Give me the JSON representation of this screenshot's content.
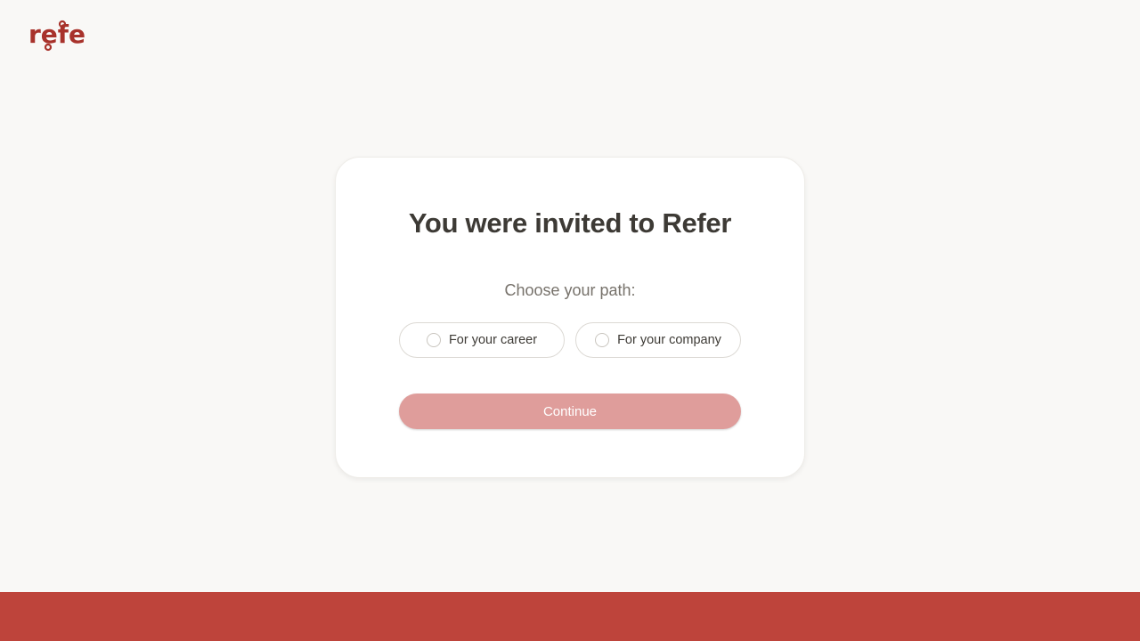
{
  "brand": {
    "logo_text": "refer",
    "color": "#a8322b"
  },
  "card": {
    "title": "You were invited to Refer",
    "subtitle": "Choose your path:",
    "options": [
      {
        "label": "For your career",
        "selected": false
      },
      {
        "label": "For your company",
        "selected": false
      }
    ],
    "continue_label": "Continue",
    "continue_enabled": false
  },
  "colors": {
    "page_background": "#f9f8f6",
    "continue_disabled": "#df9d9b",
    "footer": "#be443b"
  }
}
